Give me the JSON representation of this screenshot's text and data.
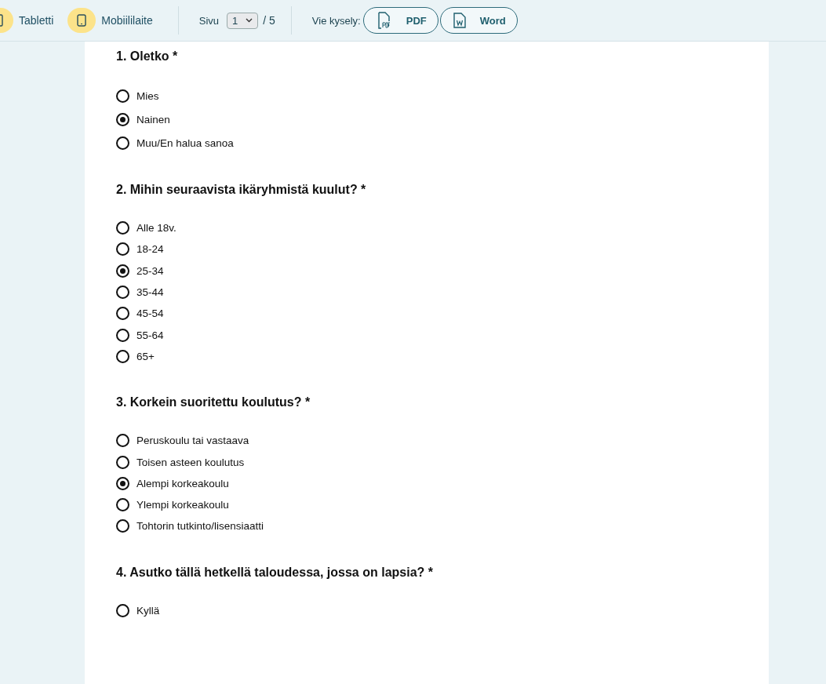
{
  "toolbar": {
    "devices": [
      {
        "label": "Tabletti",
        "kind": "tablet"
      },
      {
        "label": "Mobiililaite",
        "kind": "phone"
      }
    ],
    "page": {
      "label": "Sivu",
      "value": "1",
      "total": "/ 5"
    },
    "export": {
      "label": "Vie kysely:",
      "buttons": [
        {
          "label": "PDF",
          "kind": "pdf"
        },
        {
          "label": "Word",
          "kind": "word"
        }
      ]
    }
  },
  "questions": [
    {
      "title": "1. Oletko *",
      "options": [
        {
          "label": "Mies",
          "selected": false
        },
        {
          "label": "Nainen",
          "selected": true
        },
        {
          "label": "Muu/En halua sanoa",
          "selected": false
        }
      ]
    },
    {
      "title": "2. Mihin seuraavista ikäryhmistä kuulut? *",
      "options": [
        {
          "label": "Alle 18v.",
          "selected": false
        },
        {
          "label": "18-24",
          "selected": false
        },
        {
          "label": "25-34",
          "selected": true
        },
        {
          "label": "35-44",
          "selected": false
        },
        {
          "label": "45-54",
          "selected": false
        },
        {
          "label": "55-64",
          "selected": false
        },
        {
          "label": "65+",
          "selected": false
        }
      ]
    },
    {
      "title": "3. Korkein suoritettu koulutus? *",
      "options": [
        {
          "label": "Peruskoulu tai vastaava",
          "selected": false
        },
        {
          "label": "Toisen asteen koulutus",
          "selected": false
        },
        {
          "label": "Alempi korkeakoulu",
          "selected": true
        },
        {
          "label": "Ylempi korkeakoulu",
          "selected": false
        },
        {
          "label": "Tohtorin tutkinto/lisensiaatti",
          "selected": false
        }
      ]
    },
    {
      "title": "4. Asutko tällä hetkellä taloudessa, jossa on lapsia? *",
      "options": [
        {
          "label": "Kyllä",
          "selected": false
        }
      ]
    }
  ]
}
